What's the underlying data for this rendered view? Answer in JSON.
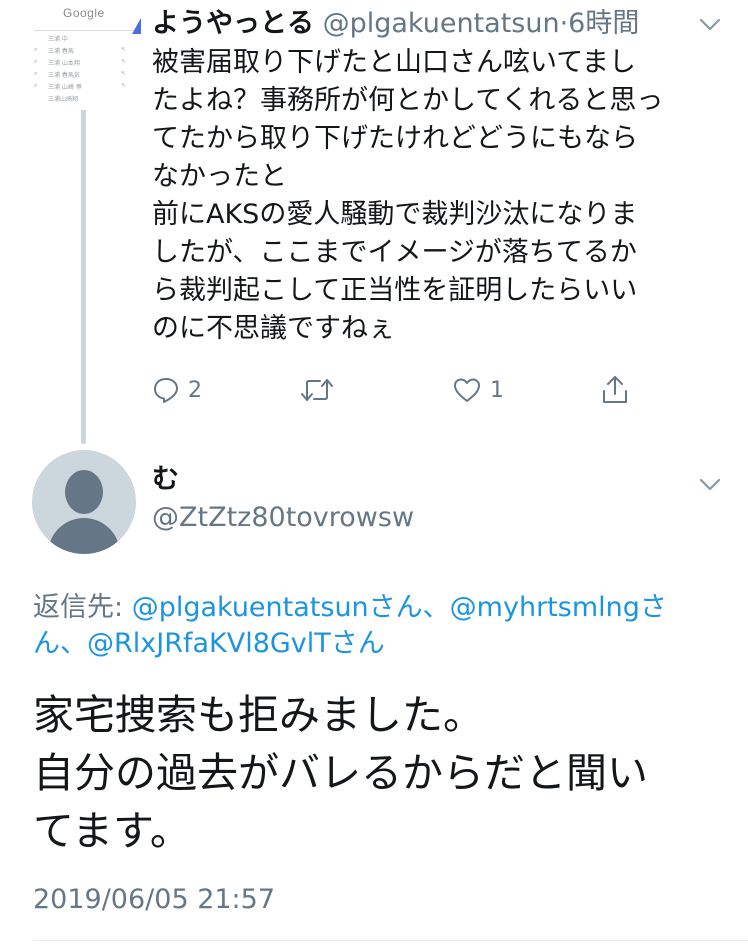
{
  "tweet1": {
    "thumbnail": {
      "logo_text": "Google",
      "rows": [
        "三浦 中",
        "三浦 春馬",
        "三浦 山本翔",
        "三浦 春馬気",
        "三浦 山崎 専",
        "三浦山崎翔"
      ]
    },
    "name": "ようやっとる",
    "handle": "@plgakuentatsun",
    "separator": "·",
    "time": "6時間",
    "body_lines": [
      "被害届取り下げたと山口さん呟いてまし",
      "たよね？事務所が何とかしてくれると思っ",
      "てたから取り下げたけれどどうにもなら",
      "なかったと",
      "前にAKSの愛人騒動で裁判沙汰になりま",
      "したが、ここまでイメージが落ちてるか",
      "ら裁判起こして正当性を証明したらいい",
      "のに不思議ですねぇ"
    ],
    "actions": {
      "reply_icon": "reply-icon",
      "reply_count": "2",
      "retweet_icon": "retweet-icon",
      "like_icon": "heart-icon",
      "like_count": "1",
      "share_icon": "share-icon"
    }
  },
  "tweet2": {
    "name": "む",
    "handle": "@ZtZtz80tovrowsw",
    "reply_prefix": "返信先: ",
    "reply_line1_user1": "@plgakuentatsun",
    "reply_line1_san1": "さん、",
    "reply_line1_user2": "@myhrtsmlng",
    "reply_line1_san2": "さ",
    "reply_line2_san2": "ん、",
    "reply_line2_user3": "@RlxJRfaKVl8GvlT",
    "reply_line2_san3": "さん",
    "text_lines": [
      "家宅捜索も拒みました。",
      "自分の過去がバレるからだと聞い",
      "てます。"
    ],
    "timestamp": "2019/06/05 21:57"
  },
  "colors": {
    "text": "#14171a",
    "muted": "#657786",
    "link": "#1b95e0",
    "thread_line": "#ccd6dd",
    "avatar_bg": "#ccd6dd"
  }
}
